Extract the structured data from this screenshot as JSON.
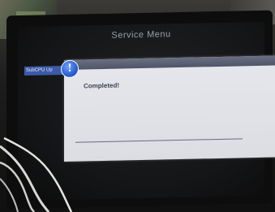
{
  "window": {
    "title": "Service Menu"
  },
  "menu": {
    "selected_item_label": "SubCPU Up"
  },
  "dialog": {
    "icon": "info-icon",
    "message": "Completed!"
  },
  "colors": {
    "screen_background": "#151617",
    "menu_highlight": "#3b5aa8",
    "dialog_background": "#e1e2e7",
    "dialog_titlebar": "#575c70",
    "info_icon": "#2a5fd0"
  }
}
